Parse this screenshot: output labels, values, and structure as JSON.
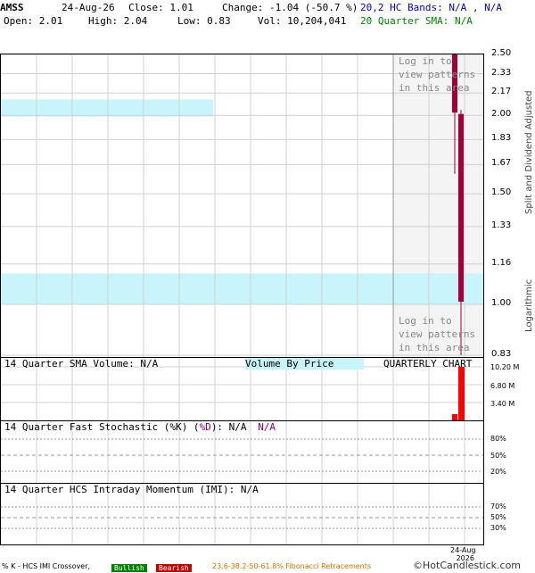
{
  "header": {
    "symbol": "AMSS",
    "date": "24-Aug-26",
    "close": "Close: 1.01",
    "change": "Change: -1.04 (-50.7 %)",
    "hc_bands": "20,2 HC Bands: N/A , N/A",
    "open": "Open: 2.01",
    "high": "High: 2.04",
    "low": "Low: 0.83",
    "vol": "Vol: 10,204,041",
    "sma20": "20 Quarter SMA: N/A"
  },
  "main": {
    "login_top": [
      "Log in to",
      "view patterns",
      "in this area"
    ],
    "login_bottom": [
      "Log in to",
      "view patterns",
      "in this area"
    ],
    "side_label_top": "Split and Dividend Adjusted",
    "side_label_bottom": "Logarithmic",
    "price_ticks": [
      "2.50",
      "2.33",
      "2.17",
      "2.00",
      "1.83",
      "1.67",
      "1.50",
      "1.33",
      "1.16",
      "1.00",
      "0.83"
    ]
  },
  "volume_panel": {
    "sma_label": "14 Quarter SMA Volume: N/A",
    "vbp_label": "Volume By Price",
    "chart_label": "QUARTERLY CHART",
    "ticks": [
      "10.20 M",
      "6.80 M",
      "3.40 M"
    ]
  },
  "stoch_panel": {
    "label_prefix": "14 Quarter Fast Stochastic (",
    "k_label": "%K",
    "sep": ") (",
    "d_label": "%D",
    "label_suffix": "): N/A",
    "na2": "N/A",
    "ticks": [
      "80%",
      "50%",
      "20%"
    ]
  },
  "imi_panel": {
    "label": "14 Quarter HCS Intraday Momentum (IMI): N/A",
    "ticks": [
      "70%",
      "50%",
      "30%"
    ]
  },
  "x_axis": {
    "label_line1": "24-Aug",
    "label_line2": "2026"
  },
  "footer": {
    "crossover": "% K - HCS IMI Crossover,",
    "bullish": "Bullish",
    "bearish": "Bearish",
    "fib": "23.6-38.2-50-61.8% Fibonacci Retracements",
    "copyright": "©HotCandlestick.com"
  },
  "colors": {
    "candle": "#a0003a",
    "volume": "#ff0000",
    "vbp": "#c8f4fc",
    "login_bg": "#f4f4f4",
    "sma_green": "#008000",
    "bands_blue": "#0000c0",
    "d_purple": "#800080",
    "fib_orange": "#d07000",
    "bullish_bg": "#008000",
    "bearish_bg": "#c00000"
  },
  "chart_data": {
    "type": "candlestick",
    "scale": "log",
    "ylim": [
      0.83,
      2.5
    ],
    "candles": [
      {
        "date": "24-Aug-26",
        "open": 2.01,
        "high": 2.04,
        "low": 0.83,
        "close": 1.01
      }
    ],
    "prior_candle": {
      "open": 2.5,
      "high": 2.5,
      "low": 1.87,
      "close": 2.02
    },
    "volume": [
      {
        "date": "24-Aug-26",
        "value": 10204041
      }
    ],
    "prior_volume": 1200000,
    "volume_ylim": [
      0,
      10200000
    ],
    "volume_by_price": [
      {
        "low": 1.99,
        "high": 2.12,
        "relative": 0.44
      },
      {
        "low": 1.0,
        "high": 1.12,
        "relative": 1.0
      }
    ]
  }
}
